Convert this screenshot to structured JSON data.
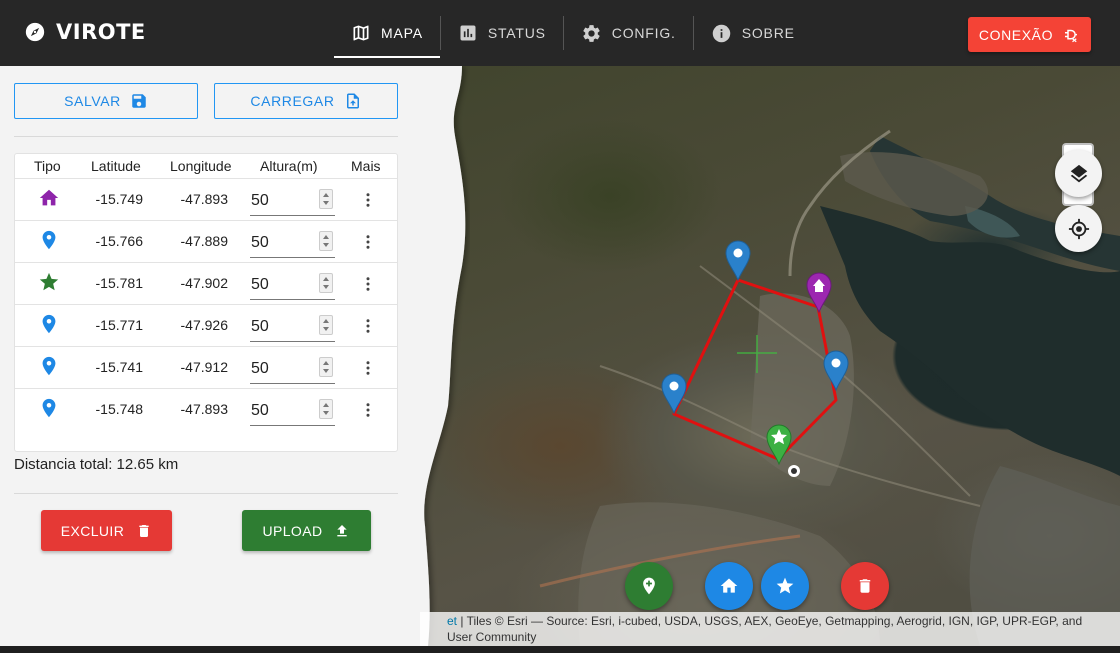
{
  "app": {
    "title": "VIROTE",
    "accent": "#f44336",
    "primary": "#2196f3"
  },
  "nav": {
    "tabs": [
      {
        "label": "MAPA",
        "icon": "map-icon",
        "active": true
      },
      {
        "label": "STATUS",
        "icon": "chart-icon",
        "active": false
      },
      {
        "label": "CONFIG.",
        "icon": "gear-icon",
        "active": false
      },
      {
        "label": "SOBRE",
        "icon": "info-icon",
        "active": false
      }
    ],
    "connect_label": "CONEXÃO"
  },
  "panel": {
    "save_label": "SALVAR",
    "load_label": "CARREGAR",
    "table": {
      "headers": [
        "Tipo",
        "Latitude",
        "Longitude",
        "Altura(m)",
        "Mais"
      ],
      "rows": [
        {
          "type": "home",
          "icon": "home-icon",
          "color": "#8e24aa",
          "lat": "-15.749",
          "lon": "-47.893",
          "alt": "50"
        },
        {
          "type": "waypoint",
          "icon": "pin-icon",
          "color": "#1e88e5",
          "lat": "-15.766",
          "lon": "-47.889",
          "alt": "50"
        },
        {
          "type": "target",
          "icon": "star-icon",
          "color": "#2e7d32",
          "lat": "-15.781",
          "lon": "-47.902",
          "alt": "50"
        },
        {
          "type": "waypoint",
          "icon": "pin-icon",
          "color": "#1e88e5",
          "lat": "-15.771",
          "lon": "-47.926",
          "alt": "50"
        },
        {
          "type": "waypoint",
          "icon": "pin-icon",
          "color": "#1e88e5",
          "lat": "-15.741",
          "lon": "-47.912",
          "alt": "50"
        },
        {
          "type": "waypoint",
          "icon": "pin-icon",
          "color": "#1e88e5",
          "lat": "-15.748",
          "lon": "-47.893",
          "alt": "50"
        }
      ]
    },
    "distance": "Distancia total: 12.65 km",
    "delete_label": "EXCLUIR",
    "upload_label": "UPLOAD"
  },
  "map": {
    "zoom_in": "+",
    "zoom_out": "−",
    "route_color": "#e01010",
    "attribution_link": "et",
    "attribution_text": " | Tiles © Esri — Source: Esri, i-cubed, USDA, USGS, AEX, GeoEye, Getmapping, Aerogrid, IGN, IGP, UPR-EGP, and",
    "attribution_text2": "User Community",
    "fabs": [
      {
        "icon": "add-location-icon",
        "color": "#2e7d32"
      },
      {
        "icon": "home-icon",
        "color": "#1e88e5"
      },
      {
        "icon": "star-icon",
        "color": "#1e88e5"
      },
      {
        "icon": "trash-icon",
        "color": "#e53935"
      }
    ]
  }
}
